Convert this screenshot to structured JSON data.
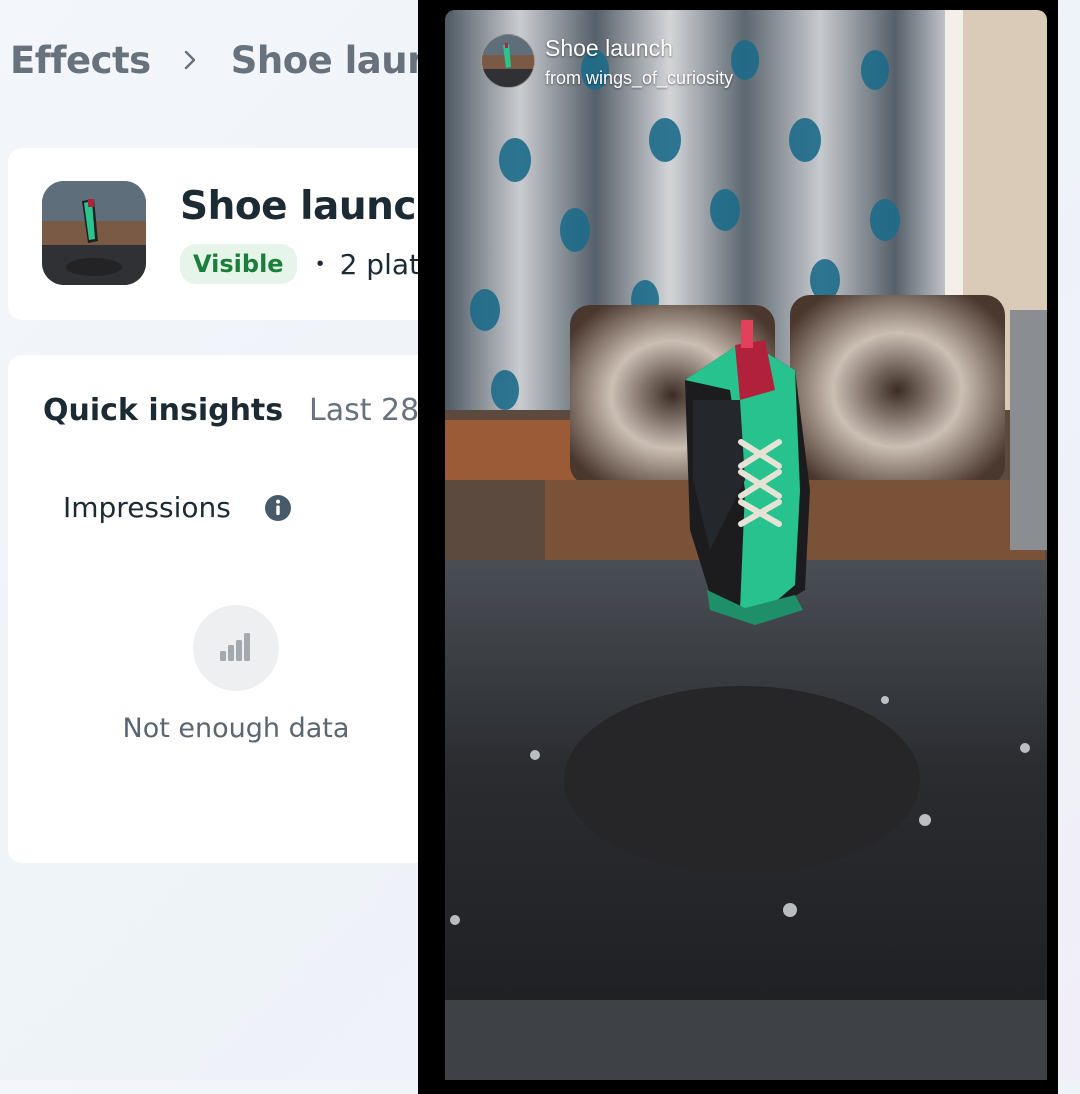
{
  "breadcrumb": {
    "root": "Effects",
    "current": "Shoe laun"
  },
  "effect": {
    "title": "Shoe launch",
    "status": "Visible",
    "platforms": "2 plat"
  },
  "insights": {
    "title": "Quick insights",
    "range": "Last 28",
    "metric_label": "Impressions",
    "empty_message": "Not enough data"
  },
  "preview": {
    "title": "Shoe launch",
    "subtitle": "from wings_of_curiosity"
  },
  "icons": {
    "breadcrumb_separator": "chevron-right-icon",
    "info": "info-icon",
    "empty_state": "bar-chart-icon"
  },
  "colors": {
    "visible_badge_bg": "#e6f4ea",
    "visible_badge_text": "#1a7f3a",
    "shoe_accent": "#27c28d"
  }
}
